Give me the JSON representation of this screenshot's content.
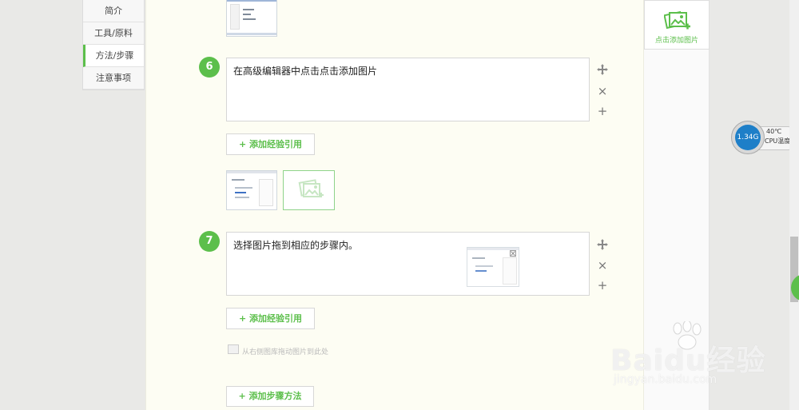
{
  "left_nav": {
    "items": [
      {
        "label": "简介"
      },
      {
        "label": "工具/原料"
      },
      {
        "label": "方法/步骤"
      },
      {
        "label": "注意事项"
      }
    ]
  },
  "steps": [
    {
      "number": "6",
      "text": "在高级编辑器中点击点击添加图片",
      "ref_button": "+ 添加经验引用"
    },
    {
      "number": "7",
      "text": "选择图片拖到相应的步骤内。",
      "ref_button": "+ 添加经验引用"
    }
  ],
  "hint": "从右侧图库拖动图片到此处",
  "add_step_button": "+ 添加步骤方法",
  "right_panel": {
    "add_image_label": "点击添加图片"
  },
  "cpu_widget": {
    "value": "1.34G",
    "temperature": "40℃",
    "label": "CPU温度"
  },
  "watermark": {
    "brand": "Baidu经验",
    "url": "jingyan.baidu.com"
  },
  "icons": {
    "move": "move-icon",
    "close": "close-icon",
    "add": "plus-icon",
    "image": "image-add-icon"
  },
  "colors": {
    "accent": "#5cbf4b",
    "cpu_blue": "#1e7fc8"
  }
}
